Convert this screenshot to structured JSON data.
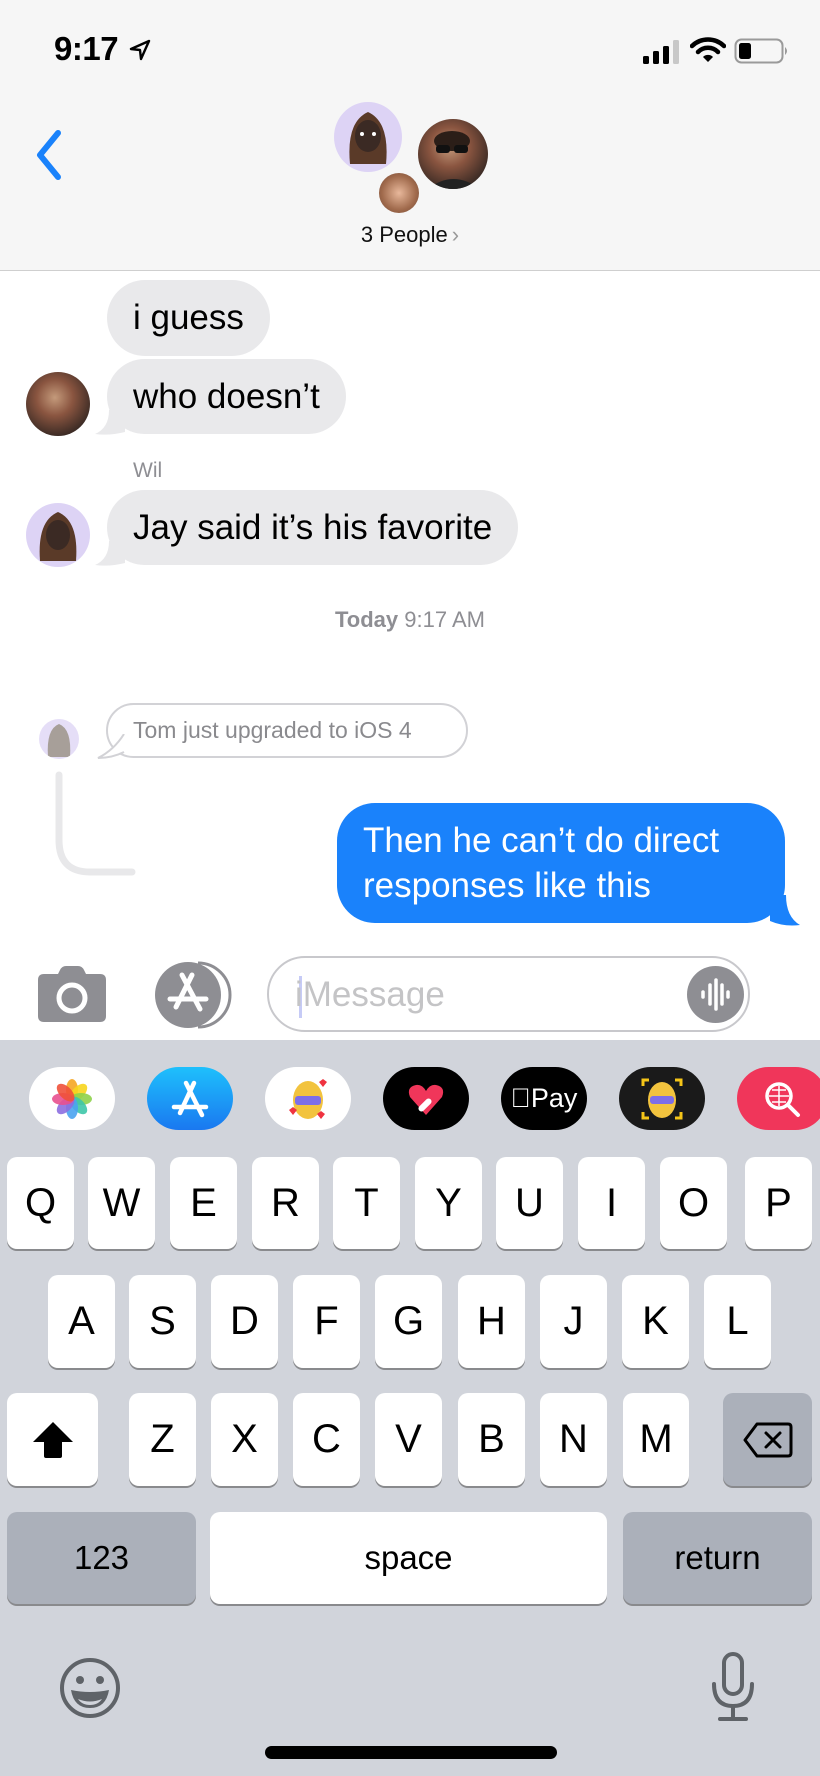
{
  "status_bar": {
    "time": "9:17",
    "location_icon": "location-arrow-icon",
    "signal_icon": "cellular-signal-icon",
    "wifi_icon": "wifi-icon",
    "battery_icon": "battery-icon",
    "battery_level_percent": 30
  },
  "header": {
    "back_icon": "chevron-left-icon",
    "participants_label": "3 People",
    "participants_chevron": "›",
    "accent_color": "#1a82fb"
  },
  "messages": [
    {
      "direction": "incoming",
      "text": "i guess"
    },
    {
      "direction": "incoming",
      "text": "who doesn’t"
    },
    {
      "direction": "incoming",
      "sender": "Wil",
      "text": "Jay said it’s his favorite"
    }
  ],
  "timestamp": {
    "day": "Today",
    "time": "9:17 AM"
  },
  "reply": {
    "quoted_text": "Tom just upgraded to iOS 4",
    "outgoing_text": "Then he can’t do direct responses like this",
    "outgoing_color": "#1a82fb"
  },
  "input_bar": {
    "camera_icon": "camera-icon",
    "apps_icon": "app-store-icon",
    "placeholder": "iMessage",
    "value": "",
    "audio_icon": "audio-waveform-icon"
  },
  "app_drawer": [
    {
      "name": "Photos",
      "icon": "photos-icon"
    },
    {
      "name": "App Store",
      "icon": "app-store-icon"
    },
    {
      "name": "Memoji Stickers",
      "icon": "memoji-stickers-icon"
    },
    {
      "name": "Digital Touch",
      "icon": "digital-touch-heart-icon"
    },
    {
      "name": "Apple Pay",
      "icon": "apple-pay-icon",
      "label": "Pay"
    },
    {
      "name": "Animoji",
      "icon": "animoji-icon"
    },
    {
      "name": "Images",
      "icon": "image-search-icon"
    }
  ],
  "keyboard": {
    "row1": [
      "Q",
      "W",
      "E",
      "R",
      "T",
      "Y",
      "U",
      "I",
      "O",
      "P"
    ],
    "row2": [
      "A",
      "S",
      "D",
      "F",
      "G",
      "H",
      "J",
      "K",
      "L"
    ],
    "row3": [
      "Z",
      "X",
      "C",
      "V",
      "B",
      "N",
      "M"
    ],
    "shift_icon": "shift-arrow-icon",
    "delete_icon": "delete-backspace-icon",
    "numbers_label": "123",
    "space_label": "space",
    "return_label": "return",
    "emoji_icon": "emoji-face-icon",
    "mic_icon": "microphone-icon"
  }
}
